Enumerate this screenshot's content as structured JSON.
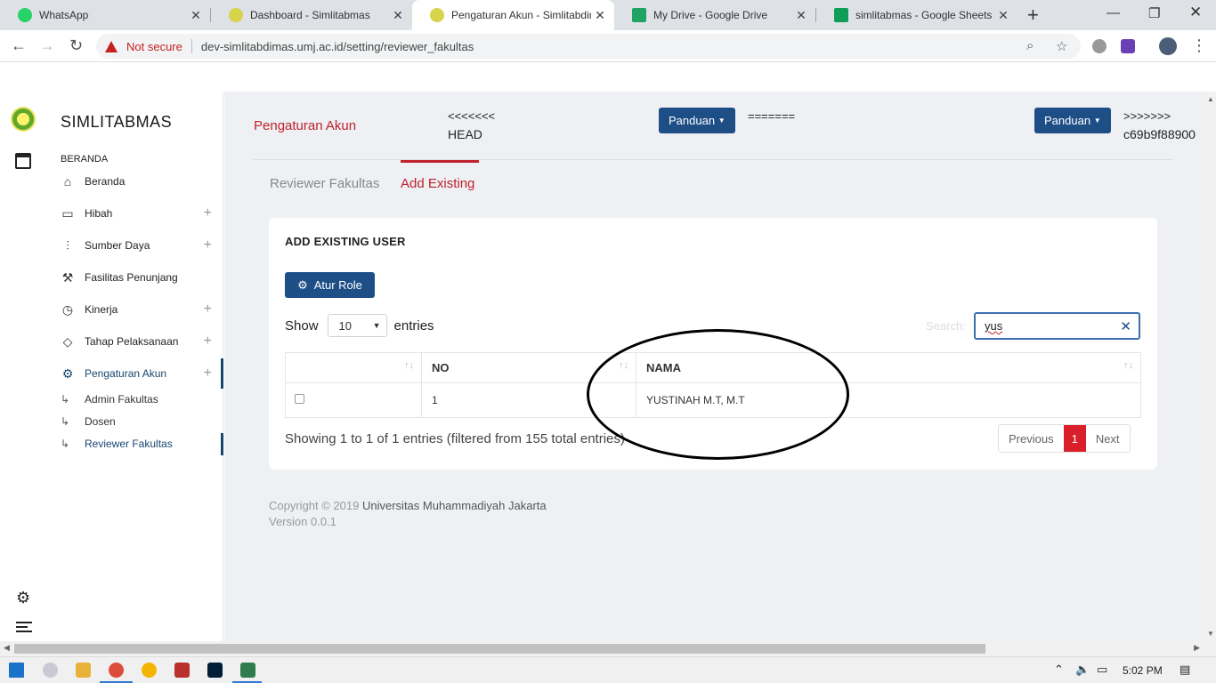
{
  "browser": {
    "tabs": [
      {
        "title": "WhatsApp",
        "icon": "whatsapp-icon",
        "color": "#25d366"
      },
      {
        "title": "Dashboard - Simlitabmas",
        "icon": "simlitabmas-icon",
        "color": "#d7d34a"
      },
      {
        "title": "Pengaturan Akun - Simlitabdim",
        "icon": "simlitabmas-icon",
        "color": "#d7d34a"
      },
      {
        "title": "My Drive - Google Drive",
        "icon": "google-drive-icon",
        "color": "#1fa463"
      },
      {
        "title": "simlitabmas - Google Sheets",
        "icon": "google-sheets-icon",
        "color": "#0f9d58"
      }
    ],
    "not_secure": "Not secure",
    "url": "dev-simlitabdimas.umj.ac.id/setting/reviewer_fakultas"
  },
  "sidebar": {
    "brand": "SIMLITABMAS",
    "section": "BERANDA",
    "items": [
      {
        "label": "Beranda",
        "icon": "home-icon",
        "plus": false
      },
      {
        "label": "Hibah",
        "icon": "card-icon",
        "plus": true
      },
      {
        "label": "Sumber Daya",
        "icon": "sliders-icon",
        "plus": true
      },
      {
        "label": "Fasilitas Penunjang",
        "icon": "wrench-icon",
        "plus": false
      },
      {
        "label": "Kinerja",
        "icon": "history-icon",
        "plus": true
      },
      {
        "label": "Tahap Pelaksanaan",
        "icon": "tag-icon",
        "plus": true
      },
      {
        "label": "Pengaturan Akun",
        "icon": "gear-icon",
        "plus": true
      }
    ],
    "subitems": [
      "Admin Fakultas",
      "Dosen",
      "Reviewer Fakultas"
    ]
  },
  "header": {
    "title": "Pengaturan Akun",
    "conflict_head_1": "<<<<<<<",
    "conflict_head_2": "HEAD",
    "conflict_mid": "=======",
    "conflict_tail_1": ">>>>>>>",
    "conflict_tail_2": "c69b9f88900",
    "panduan": "Panduan"
  },
  "tabs": {
    "reviewer": "Reviewer Fakultas",
    "add_existing": "Add Existing"
  },
  "card": {
    "title": "ADD EXISTING USER",
    "atur_role": "Atur Role",
    "show": "Show",
    "entries_value": "10",
    "entries": "entries",
    "search_label": "Search:",
    "search_value": "yus",
    "columns": [
      "",
      "NO",
      "NAMA"
    ],
    "rows": [
      {
        "no": "1",
        "nama": "YUSTINAH M.T, M.T"
      }
    ],
    "showing": "Showing 1 to 1 of 1 entries (filtered from 155 total entries)",
    "pager": {
      "prev": "Previous",
      "current": "1",
      "next": "Next"
    }
  },
  "footer": {
    "copyright": "Copyright © 2019 ",
    "university": "Universitas Muhammadiyah Jakarta",
    "version": "Version 0.0.1"
  },
  "taskbar": {
    "time": "5:02 PM"
  }
}
